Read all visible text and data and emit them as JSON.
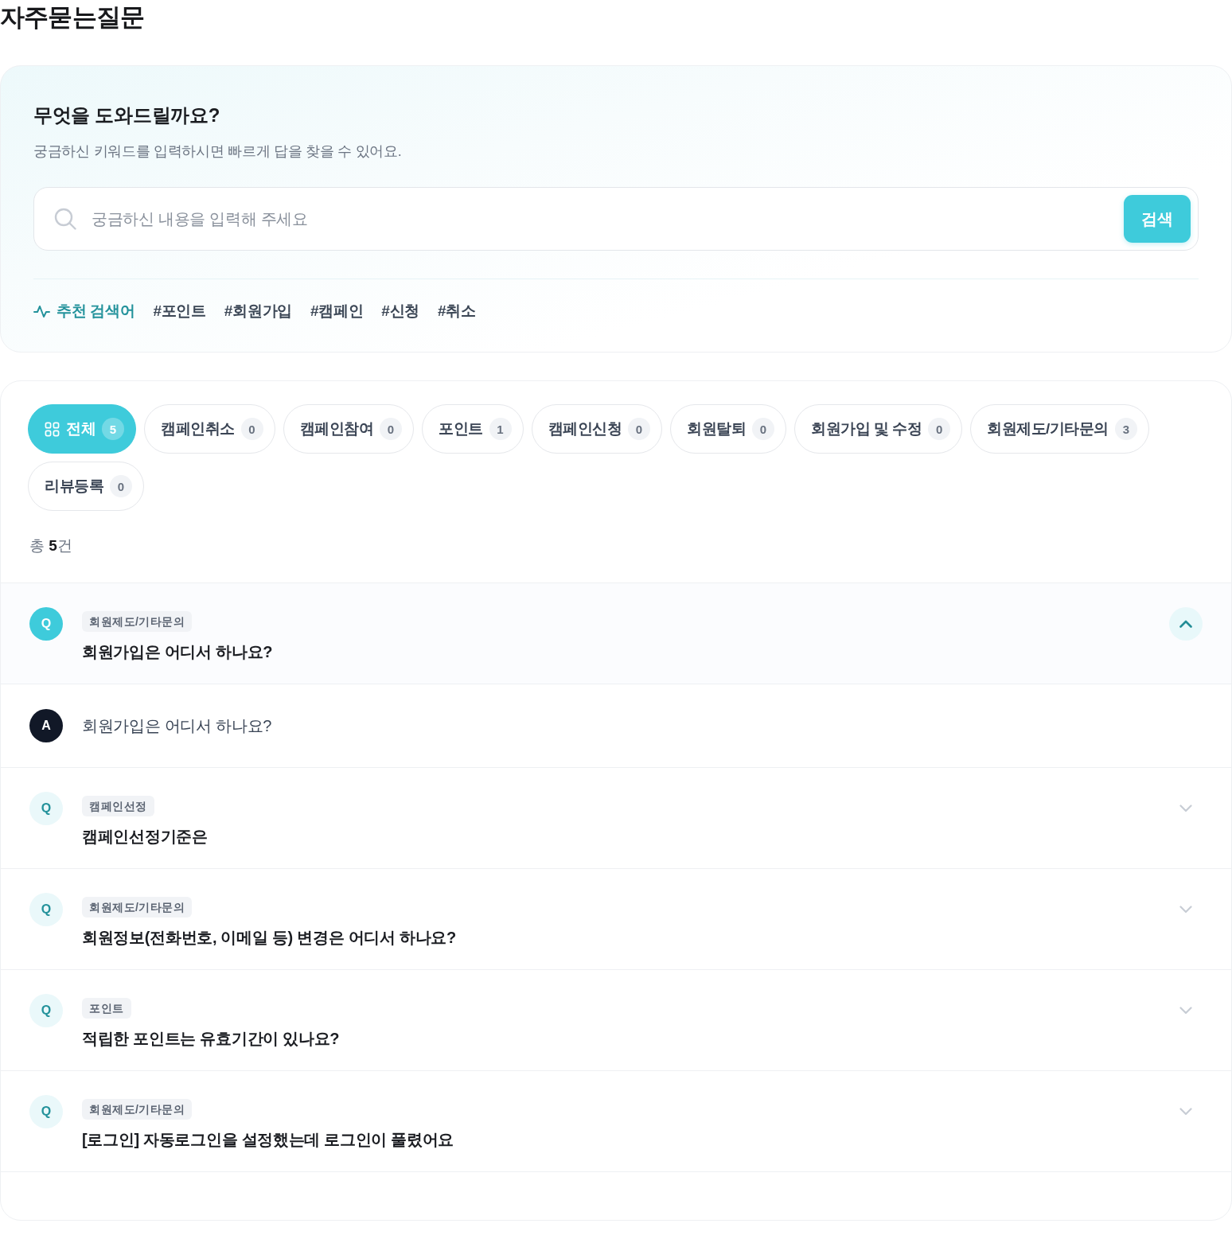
{
  "page_title": "자주묻는질문",
  "search_panel": {
    "heading": "무엇을 도와드릴까요?",
    "subtitle": "궁금하신 키워드를 입력하시면 빠르게 답을 찾을 수 있어요.",
    "search_field": {
      "placeholder": "궁금하신 내용을 입력해 주세요"
    },
    "search_button": "검색",
    "recommended": {
      "label": "추천 검색어",
      "keywords": [
        "#포인트",
        "#회원가입",
        "#캠페인",
        "#신청",
        "#취소"
      ]
    }
  },
  "categories": [
    {
      "kind": "all",
      "label": "전체",
      "count": "5",
      "selected": true
    },
    {
      "kind": "category",
      "label": "캠페인취소",
      "count": "0",
      "selected": false
    },
    {
      "kind": "category",
      "label": "캠페인참여",
      "count": "0",
      "selected": false
    },
    {
      "kind": "category",
      "label": "포인트",
      "count": "1",
      "selected": false
    },
    {
      "kind": "category",
      "label": "캠페인신청",
      "count": "0",
      "selected": false
    },
    {
      "kind": "category",
      "label": "회원탈퇴",
      "count": "0",
      "selected": false
    },
    {
      "kind": "category",
      "label": "회원가입 및 수정",
      "count": "0",
      "selected": false
    },
    {
      "kind": "category",
      "label": "회원제도/기타문의",
      "count": "3",
      "selected": false
    },
    {
      "kind": "category",
      "label": "리뷰등록",
      "count": "0",
      "selected": false
    }
  ],
  "total_text": "총 **5**건",
  "faqs": [
    {
      "badge": "Q",
      "category": "회원제도/기타문의",
      "question": "회원가입은 어디서 하나요?",
      "expanded": true,
      "answer": {
        "badge": "A",
        "text": "회원가입은 어디서 하나요?"
      }
    },
    {
      "badge": "Q",
      "category": "캠페인선정",
      "question": "캠페인선정기준은",
      "expanded": false
    },
    {
      "badge": "Q",
      "category": "회원제도/기타문의",
      "question": "회원정보(전화번호, 이메일 등) 변경은 어디서 하나요?",
      "expanded": false
    },
    {
      "badge": "Q",
      "category": "포인트",
      "question": "적립한 포인트는 유효기간이 있나요?",
      "expanded": false
    },
    {
      "badge": "Q",
      "category": "회원제도/기타문의",
      "question": "[로그인] 자동로그인을 설정했는데 로그인이 풀렸어요",
      "expanded": false
    }
  ]
}
